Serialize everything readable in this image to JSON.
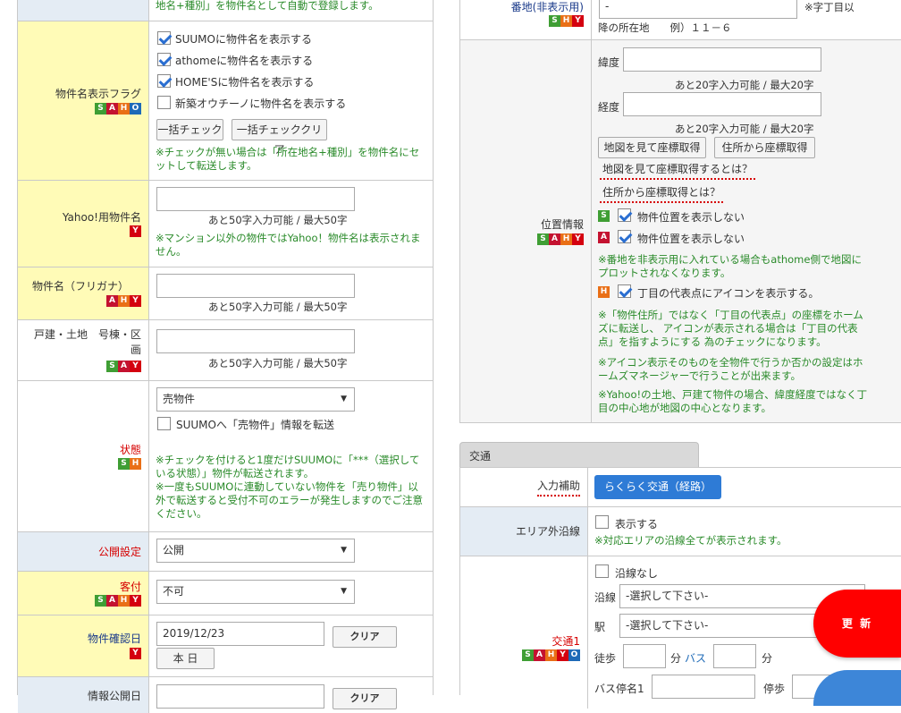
{
  "left": {
    "top_note": "地名+種別」を物件名として自動で登録します。",
    "flag": {
      "label": "物件名表示フラグ",
      "badges": [
        "S",
        "A",
        "H",
        "O"
      ],
      "checks": [
        {
          "label": "SUUMOに物件名を表示する",
          "checked": true
        },
        {
          "label": "athomeに物件名を表示する",
          "checked": true
        },
        {
          "label": "HOME'Sに物件名を表示する",
          "checked": true
        },
        {
          "label": "新築オウチーノに物件名を表示する",
          "checked": false
        }
      ],
      "btn_check": "一括チェック",
      "btn_clear": "一括チェッククリア",
      "note": "※チェックが無い場合は「所在地名+種別」を物件名にセットして転送します。"
    },
    "yahoo": {
      "label": "Yahoo!用物件名",
      "badges": [
        "Y"
      ],
      "value": "",
      "counter": "あと50字入力可能 / 最大50字",
      "note": "※マンション以外の物件ではYahoo！物件名は表示されません。"
    },
    "kana": {
      "label": "物件名（フリガナ）",
      "badges": [
        "A",
        "H",
        "Y"
      ],
      "value": "",
      "counter": "あと50字入力可能 / 最大50字"
    },
    "gou": {
      "label": "戸建・土地　号棟・区画",
      "badges": [
        "S",
        "A",
        "Y"
      ],
      "value": "",
      "counter": "あと50字入力可能 / 最大50字"
    },
    "state": {
      "label": "状態",
      "badges": [
        "S",
        "H"
      ],
      "selected": "売物件",
      "check": "SUUMOへ「売物件」情報を転送",
      "note": "※チェックを付けると1度だけSUUMOに「***（選択している状態）」物件が転送されます。\n※一度もSUUMOに連動していない物件を「売り物件」以外で転送すると受付不可のエラーが発生しますのでご注意ください。"
    },
    "public": {
      "label": "公開設定",
      "selected": "公開"
    },
    "kifu": {
      "label": "客付",
      "badges": [
        "S",
        "A",
        "H",
        "Y"
      ],
      "selected": "不可"
    },
    "confirm": {
      "label": "物件確認日",
      "badges": [
        "Y"
      ],
      "value": "2019/12/23",
      "btn_clear": "クリア",
      "btn_today": "本 日"
    },
    "pubdate": {
      "label": "情報公開日",
      "btn_clear": "クリア"
    }
  },
  "right": {
    "banchi": {
      "label": "番地(非表示用)",
      "badges": [
        "S",
        "H",
        "Y"
      ],
      "value": "-",
      "suffix": "※字丁目以",
      "line2": "降の所在地　　例）１１－６"
    },
    "geo": {
      "label": "位置情報",
      "badges": [
        "S",
        "A",
        "H",
        "Y"
      ],
      "lat_label": "緯度",
      "lng_label": "経度",
      "lat_counter": "あと20字入力可能 / 最大20字",
      "lng_counter": "あと20字入力可能 / 最大20字",
      "btn_map": "地図を見て座標取得",
      "btn_addr": "住所から座標取得",
      "link_map": "地図を見て座標取得するとは？",
      "link_addr": "住所から座標取得とは？",
      "hideS": "物件位置を表示しない",
      "hideA": "物件位置を表示しない",
      "note1": "※番地を非表示用に入れている場合もathome側で地図にプロットされなくなります。",
      "iconH": "丁目の代表点にアイコンを表示する。",
      "note2": "※「物件住所」ではなく「丁目の代表点」の座標をホームズに転送し、 アイコンが表示される場合は「丁目の代表点」を指すようにする 為のチェックになります。",
      "note3": "※アイコン表示そのものを全物件で行うか否かの設定はホームズマネージャーで行うことが出来ます。",
      "note4": "※Yahoo!の土地、戸建て物件の場合、緯度経度ではなく丁目の中心地が地図の中心となります。"
    },
    "kotsu": {
      "tab": "交通",
      "assist_label": "入力補助",
      "assist_btn": "らくらく交通（経路）",
      "area_label": "エリア外沿線",
      "area_check": "表示する",
      "area_note": "※対応エリアの沿線全てが表示されます。",
      "t1_label": "交通1",
      "t1_badges": [
        "S",
        "A",
        "H",
        "Y",
        "O"
      ],
      "no_line": "沿線なし",
      "line_label": "沿線",
      "line_sel": "-選択して下さい-",
      "st_label": "駅",
      "st_sel": "-選択して下さい-",
      "walk": "徒歩",
      "min1": "分",
      "bus": "バス",
      "min2": "分",
      "busstop": "バス停名1",
      "stop": "停歩"
    },
    "update": "更 新"
  }
}
